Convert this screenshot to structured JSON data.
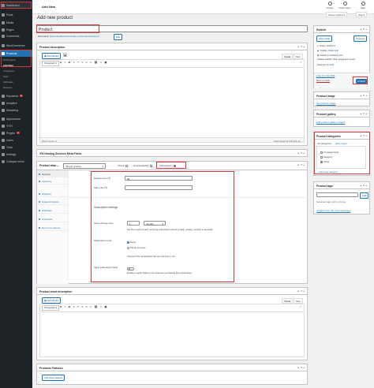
{
  "sidebar": {
    "items": [
      {
        "label": "Dashboard"
      },
      {
        "label": "Posts"
      },
      {
        "label": "Media"
      },
      {
        "label": "Pages"
      },
      {
        "label": "Comments"
      },
      {
        "label": "WooCommerce"
      },
      {
        "label": "Products"
      },
      {
        "label": "Payments",
        "badge": "1"
      },
      {
        "label": "Analytics"
      },
      {
        "label": "Marketing"
      },
      {
        "label": "Appearance"
      },
      {
        "label": "YITH"
      },
      {
        "label": "Plugins",
        "badge": "2"
      },
      {
        "label": "Users"
      },
      {
        "label": "Tools"
      },
      {
        "label": "Settings"
      },
      {
        "label": "Collapse menu"
      }
    ],
    "products_sub": [
      "All Products",
      "Add New",
      "Categories",
      "Tags",
      "Attributes",
      "Reviews"
    ]
  },
  "topbar": {
    "title": "Add New",
    "actions": [
      "Activity",
      "Finish setup",
      "Help"
    ],
    "screen_options": "Screen Options",
    "help": "Help"
  },
  "page": {
    "heading": "Add new product"
  },
  "product": {
    "title": "Product",
    "permalink_label": "Permalink:",
    "permalink_url": "https://localhost/dev/index.php/product/product/",
    "edit_button": "Edit"
  },
  "description": {
    "header": "Product description",
    "add_media": "Add Media",
    "tab_visual": "Visual",
    "tab_text": "Text",
    "format": "Paragraph",
    "word_count": "Word count: 0",
    "draft_saved": "Draft saved at 5:53:18 pm."
  },
  "media_fields": {
    "header": "VW Hosting Services Meta Fields"
  },
  "product_data": {
    "header": "Product data —",
    "type": "Simple product",
    "virtual": "Virtual:",
    "downloadable": "Downloadable:",
    "subscription": "Subscription:",
    "tabs": [
      "General",
      "Inventory",
      "Shipping",
      "Linked Products",
      "Attributes",
      "Advanced",
      "Get more options"
    ],
    "regular_price_label": "Regular price (₹)",
    "regular_price_value": "60",
    "sale_price_label": "Sale price (₹)",
    "subscription_settings": "Subscription Settings",
    "users_pay_every": "Users will pay every",
    "interval_value": "1",
    "interval_unit": "months",
    "interval_help": "Set the length of each recurring subscription period to daily, weekly, monthly or annually.",
    "subscription_ends": "Subscription ends",
    "ends_never": "Never",
    "ends_set": "Set an end time",
    "ends_help": "Choose if the subscription has an end time or not.",
    "apply_fields": "Apply subscription fields",
    "apply_help": "Enable to apply fields to the customer purchasing this subscription."
  },
  "short_description": {
    "header": "Product short description",
    "add_media": "Add Media",
    "tab_visual": "Visual",
    "tab_text": "Text",
    "format": "Paragraph"
  },
  "features": {
    "header": "Products Features",
    "add_button": "Add New Feature"
  },
  "publish": {
    "header": "Publish",
    "save_draft": "Save Draft",
    "preview": "Preview",
    "status": "Status: Draft",
    "visibility": "Visibility: Public",
    "publish_time": "Publish immediately",
    "catalog_visibility": "Catalog visibility: Shop and search results",
    "featured": "Featured: No",
    "copy_draft": "Copy to a new draft",
    "trash": "Move to Trash",
    "publish_button": "Publish",
    "edit": "Edit"
  },
  "product_image": {
    "header": "Product image",
    "link": "Set product image"
  },
  "gallery": {
    "header": "Product gallery",
    "link": "Add product gallery images"
  },
  "categories": {
    "header": "Product categories",
    "tab_all": "All categories",
    "tab_most": "Most Used",
    "items": [
      "Uncategorized",
      "category",
      "Other"
    ],
    "add_new": "+ Add new category"
  },
  "tags": {
    "header": "Product tags",
    "add_button": "Add",
    "hint": "Separate tags with commas",
    "choose": "Choose from the most used tags"
  }
}
